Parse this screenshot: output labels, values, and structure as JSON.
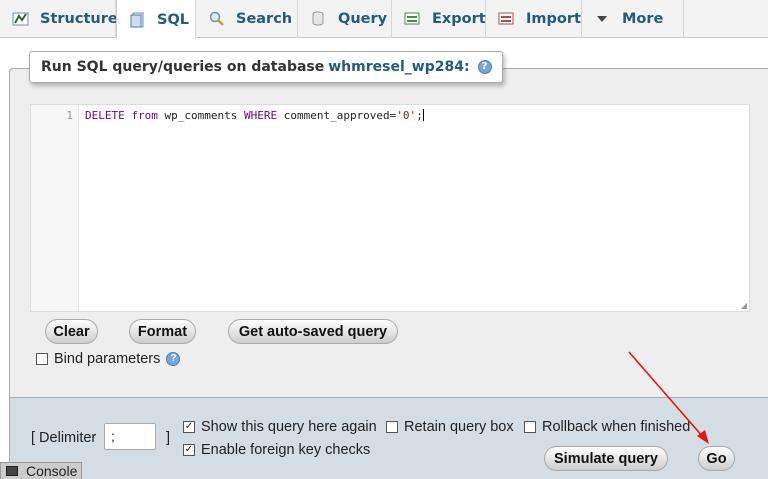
{
  "tabs": [
    {
      "label": "Structure",
      "icon": "structure-icon"
    },
    {
      "label": "SQL",
      "icon": "sql-icon",
      "active": true
    },
    {
      "label": "Search",
      "icon": "search-icon"
    },
    {
      "label": "Query",
      "icon": "query-icon"
    },
    {
      "label": "Export",
      "icon": "export-icon"
    },
    {
      "label": "Import",
      "icon": "import-icon"
    },
    {
      "label": "More",
      "icon": "chevron-down-icon"
    }
  ],
  "legend": {
    "prefix": "Run SQL query/queries on database",
    "database": "whmresel_wp284:"
  },
  "editor": {
    "line_number": "1",
    "tokens": {
      "k1": "DELETE",
      "k2": "from",
      "t1": " wp_comments ",
      "k3": "WHERE",
      "t2": " comment_approved=",
      "s1": "'0'",
      "t3": ";"
    }
  },
  "buttons": {
    "clear": "Clear",
    "format": "Format",
    "autosave": "Get auto-saved query",
    "simulate": "Simulate query",
    "go": "Go"
  },
  "bind_parameters": {
    "label": "Bind parameters",
    "checked": false
  },
  "delimiter": {
    "open": "[ Delimiter",
    "value": ";",
    "close": "]"
  },
  "options": {
    "show_query": {
      "label": "Show this query here again",
      "checked": true
    },
    "retain_box": {
      "label": "Retain query box",
      "checked": false
    },
    "rollback": {
      "label": "Rollback when finished",
      "checked": false
    },
    "foreign_keys": {
      "label": "Enable foreign key checks",
      "checked": true
    }
  },
  "console": {
    "label": "Console"
  },
  "colors": {
    "link": "#235a81",
    "panel": "#eeeeee",
    "lower_panel": "#d5dde4",
    "arrow": "#e8140e"
  }
}
